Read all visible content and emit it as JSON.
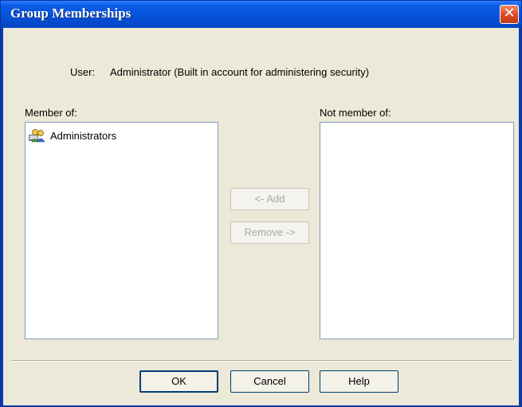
{
  "window": {
    "title": "Group Memberships",
    "close_glyph": "✕"
  },
  "user": {
    "label": "User:",
    "value": "Administrator (Built in account for administering security)"
  },
  "member_of": {
    "label": "Member of:",
    "items": [
      {
        "icon": "group-users-icon",
        "label": "Administrators"
      }
    ]
  },
  "not_member_of": {
    "label": "Not member of:",
    "items": []
  },
  "transfer": {
    "add_label": "<- Add",
    "remove_label": "Remove ->"
  },
  "footer": {
    "ok_label": "OK",
    "cancel_label": "Cancel",
    "help_label": "Help"
  }
}
